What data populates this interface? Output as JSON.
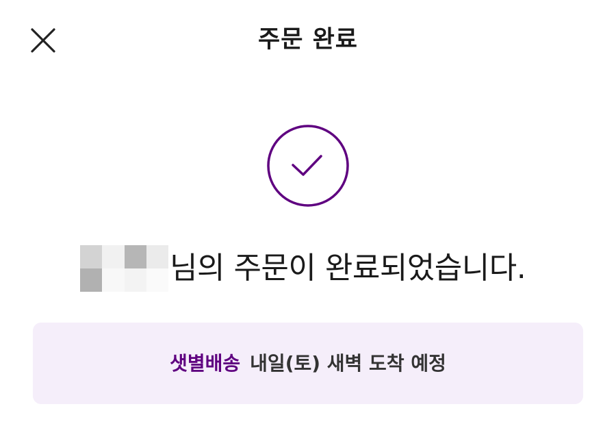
{
  "header": {
    "close_icon": "close-icon",
    "title": "주문 완료"
  },
  "confirmation": {
    "check_icon": "check-circle-icon",
    "accent_color": "#5f0080",
    "message": "님의 주문이 완료되었습니다."
  },
  "delivery": {
    "type": "샛별배송",
    "description": "내일(토) 새벽 도착 예정",
    "box_color": "#f5eefa"
  }
}
